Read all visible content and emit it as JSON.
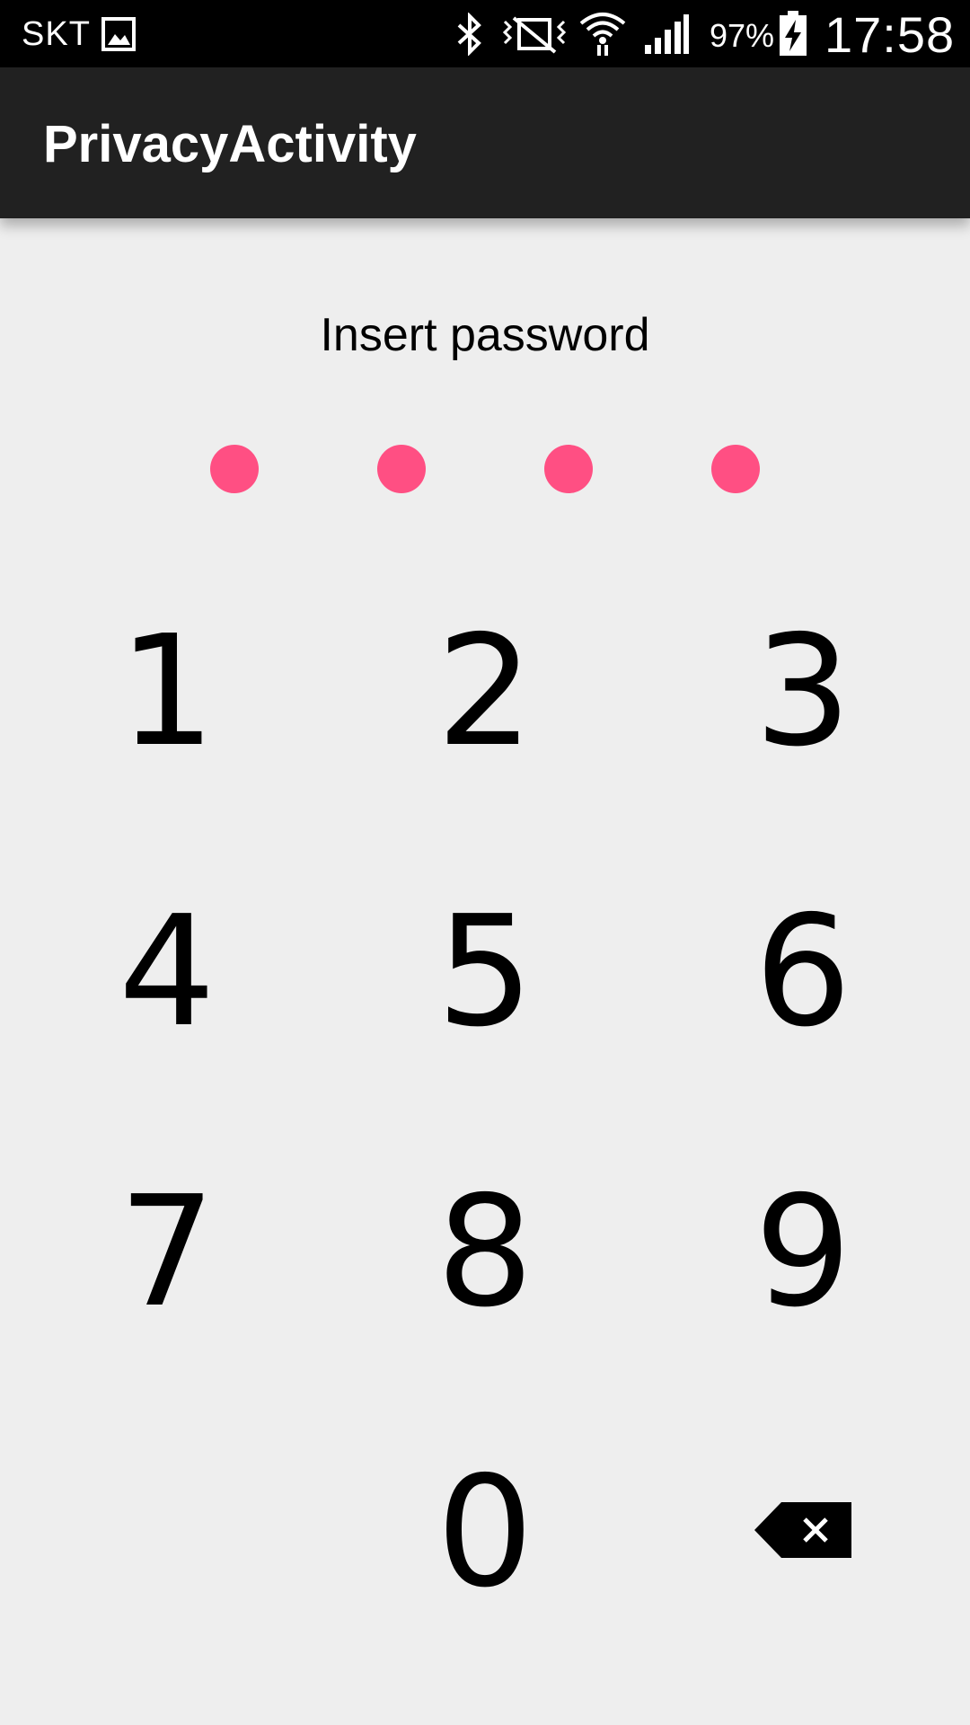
{
  "status_bar": {
    "carrier": "SKT",
    "battery_percent": "97%",
    "time": "17:58",
    "icons": [
      "image-notification-icon",
      "bluetooth-icon",
      "vibrate-off-icon",
      "wifi-icon",
      "signal-icon",
      "battery-charging-icon"
    ]
  },
  "action_bar": {
    "title": "PrivacyActivity"
  },
  "pin": {
    "prompt": "Insert password",
    "dot_count": 4,
    "dot_color": "#ff4f83"
  },
  "keypad": {
    "keys": [
      "1",
      "2",
      "3",
      "4",
      "5",
      "6",
      "7",
      "8",
      "9",
      "0"
    ],
    "backspace_icon": "backspace-icon"
  },
  "colors": {
    "background": "#eeeeee",
    "action_bar": "#212121",
    "status_bar": "#000000",
    "accent": "#ff4f83"
  }
}
